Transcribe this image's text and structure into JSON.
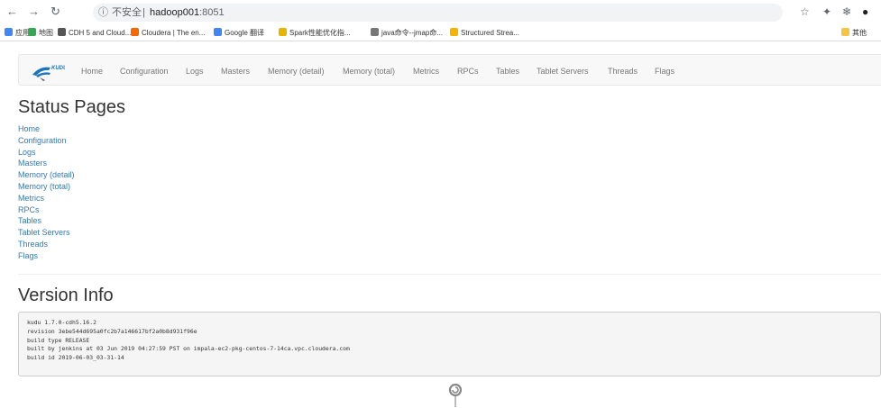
{
  "browser": {
    "omnibox": {
      "security_label": "不安全",
      "separator": "|",
      "host": "hadoop001",
      "port": ":8051"
    },
    "bookmarks": [
      {
        "label": "应用",
        "color": "#4285f4"
      },
      {
        "label": "地图",
        "color": "#34a853"
      },
      {
        "label": "CDH 5 and Cloud...",
        "color": "#555555"
      },
      {
        "label": "Cloudera | The en...",
        "color": "#f96702"
      },
      {
        "label": "Google 翻译",
        "color": "#4285f4"
      },
      {
        "label": "Spark性能优化指...",
        "color": "#e8b400"
      },
      {
        "label": "java命令--jmap命...",
        "color": "#777777"
      },
      {
        "label": "Structured Strea...",
        "color": "#f4b400"
      },
      {
        "label": "其他",
        "color": "#f4c542"
      }
    ]
  },
  "navbar": {
    "links": [
      "Home",
      "Configuration",
      "Logs",
      "Masters",
      "Memory (detail)",
      "Memory (total)",
      "Metrics",
      "RPCs",
      "Tables",
      "Tablet Servers",
      "Threads",
      "Flags"
    ]
  },
  "status": {
    "title": "Status Pages",
    "links": [
      "Home",
      "Configuration",
      "Logs",
      "Masters",
      "Memory (detail)",
      "Memory (total)",
      "Metrics",
      "RPCs",
      "Tables",
      "Tablet Servers",
      "Threads",
      "Flags"
    ]
  },
  "version": {
    "title": "Version Info",
    "lines": [
      "kudu 1.7.0-cdh5.16.2",
      "revision 3ebe544d695a0fc2b7a146617bf2a0b8d931f96e",
      "build type RELEASE",
      "built by jenkins at 03 Jun 2019 04:27:59 PST on impala-ec2-pkg-centos-7-14ca.vpc.cloudera.com",
      "build id 2019-06-03_03-31-14"
    ]
  },
  "colors": {
    "link": "#337ab7",
    "nav_text": "#777777",
    "navbar_bg": "#f8f8f8",
    "pre_bg": "#f5f5f5"
  }
}
